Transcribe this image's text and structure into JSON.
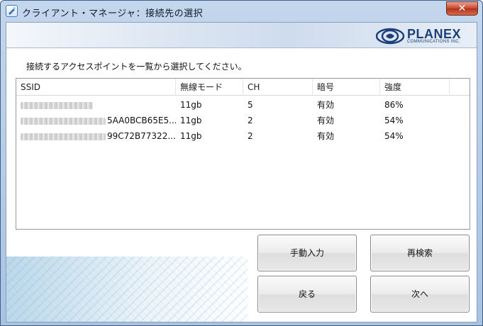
{
  "window": {
    "title": "クライアント・マネージャ：接続先の選択",
    "close_label": "✕"
  },
  "logo": {
    "name": "PLANEX",
    "sub": "COMMUNICATIONS INC."
  },
  "instruction": "接続するアクセスポイントを一覧から選択してください。",
  "table": {
    "columns": [
      "SSID",
      "無線モード",
      "CH",
      "暗号",
      "強度"
    ],
    "rows": [
      {
        "ssid_visible": "",
        "mode": "11gb",
        "ch": "5",
        "enc": "有効",
        "strength": "86%"
      },
      {
        "ssid_visible": "5AA0BCB65E5...",
        "mode": "11gb",
        "ch": "2",
        "enc": "有効",
        "strength": "54%"
      },
      {
        "ssid_visible": "99C72B77322...",
        "mode": "11gb",
        "ch": "2",
        "enc": "有効",
        "strength": "54%"
      }
    ]
  },
  "buttons": {
    "manual": "手動入力",
    "rescan": "再検索",
    "back": "戻る",
    "next": "次へ"
  },
  "colors": {
    "title_bar": "#b7cde8",
    "close": "#c7452a",
    "brand": "#1c3f7a"
  }
}
